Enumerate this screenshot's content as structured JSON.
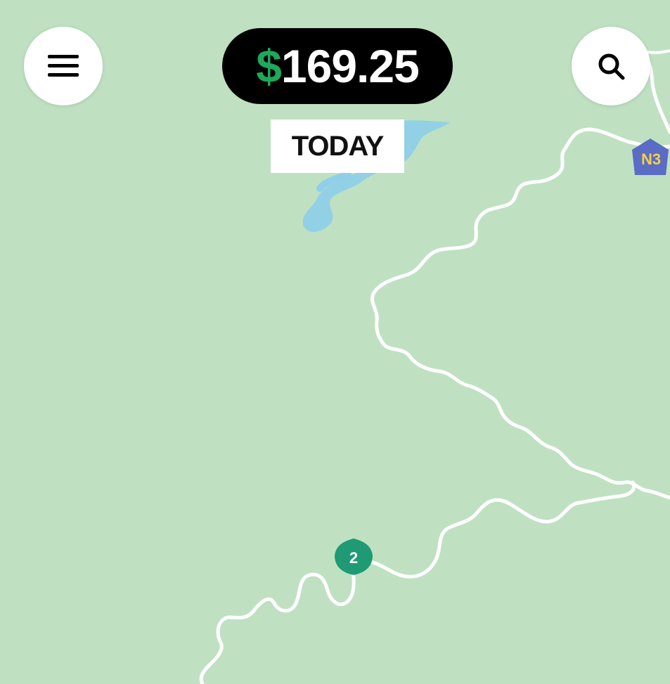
{
  "header": {
    "currency_symbol": "$",
    "earnings_amount": "169.25",
    "period_label": "TODAY"
  },
  "map": {
    "route_markers": [
      {
        "label": "N3",
        "color": "#5a6cc4",
        "text_color": "#f3d046"
      },
      {
        "label": "2",
        "color": "#1f9a75",
        "text_color": "#ffffff"
      }
    ]
  },
  "colors": {
    "map_background": "#bfe1c2",
    "water": "#8fcfe8",
    "road": "#ffffff",
    "earnings_accent": "#1fa85a"
  },
  "icons": {
    "menu": "hamburger-menu-icon",
    "search": "magnifier-icon"
  }
}
